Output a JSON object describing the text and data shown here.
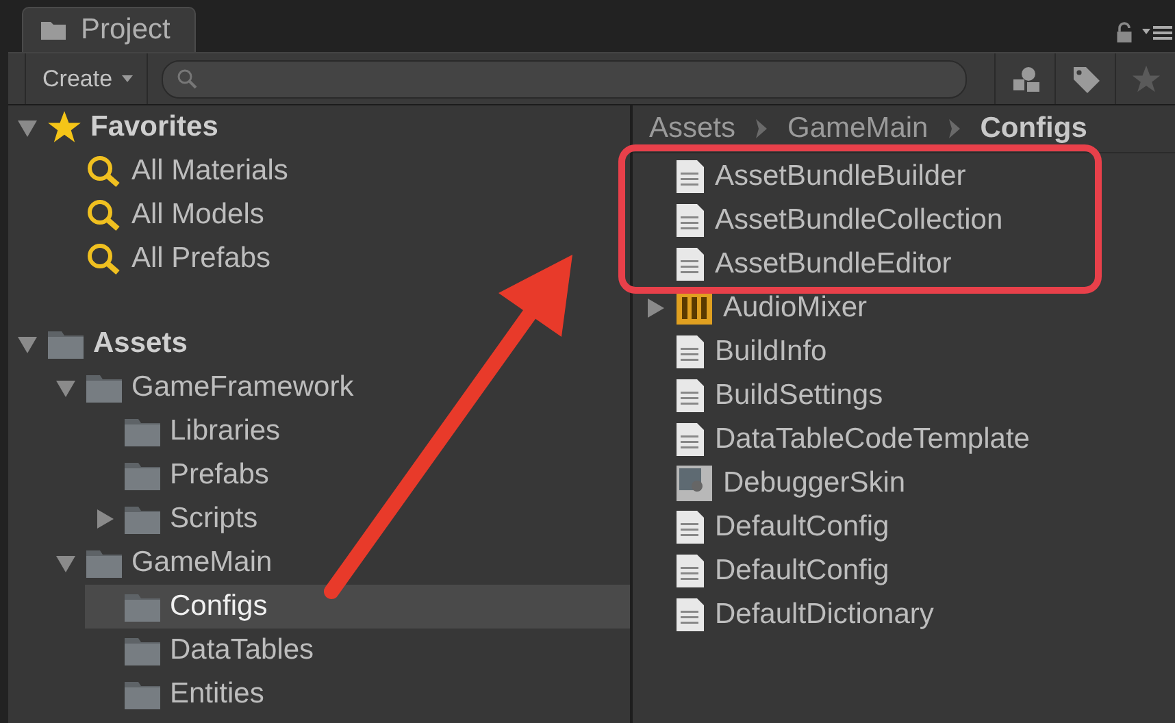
{
  "tab": {
    "title": "Project"
  },
  "toolbar": {
    "create_label": "Create"
  },
  "tree": [
    {
      "label": "Favorites",
      "kind": "favorites",
      "expanded": true,
      "selected": false,
      "children": [
        {
          "label": "All Materials",
          "kind": "search",
          "selected": false
        },
        {
          "label": "All Models",
          "kind": "search",
          "selected": false
        },
        {
          "label": "All Prefabs",
          "kind": "search",
          "selected": false
        }
      ]
    },
    {
      "label": "Assets",
      "kind": "folder",
      "expanded": true,
      "selected": false,
      "children": [
        {
          "label": "GameFramework",
          "kind": "folder",
          "expanded": true,
          "selected": false,
          "children": [
            {
              "label": "Libraries",
              "kind": "folder",
              "selected": false
            },
            {
              "label": "Prefabs",
              "kind": "folder",
              "selected": false
            },
            {
              "label": "Scripts",
              "kind": "folder",
              "expanded": false,
              "selected": false
            }
          ]
        },
        {
          "label": "GameMain",
          "kind": "folder",
          "expanded": true,
          "selected": false,
          "children": [
            {
              "label": "Configs",
              "kind": "folder",
              "selected": true
            },
            {
              "label": "DataTables",
              "kind": "folder",
              "selected": false
            },
            {
              "label": "Entities",
              "kind": "folder",
              "selected": false
            }
          ]
        }
      ]
    }
  ],
  "breadcrumb": [
    "Assets",
    "GameMain",
    "Configs"
  ],
  "files": [
    {
      "label": "AssetBundleBuilder",
      "kind": "text"
    },
    {
      "label": "AssetBundleCollection",
      "kind": "text"
    },
    {
      "label": "AssetBundleEditor",
      "kind": "text"
    },
    {
      "label": "AudioMixer",
      "kind": "mixer",
      "expanded": false
    },
    {
      "label": "BuildInfo",
      "kind": "text"
    },
    {
      "label": "BuildSettings",
      "kind": "text"
    },
    {
      "label": "DataTableCodeTemplate",
      "kind": "text"
    },
    {
      "label": "DebuggerSkin",
      "kind": "skin"
    },
    {
      "label": "DefaultConfig",
      "kind": "text"
    },
    {
      "label": "DefaultConfig",
      "kind": "text"
    },
    {
      "label": "DefaultDictionary",
      "kind": "text"
    }
  ]
}
